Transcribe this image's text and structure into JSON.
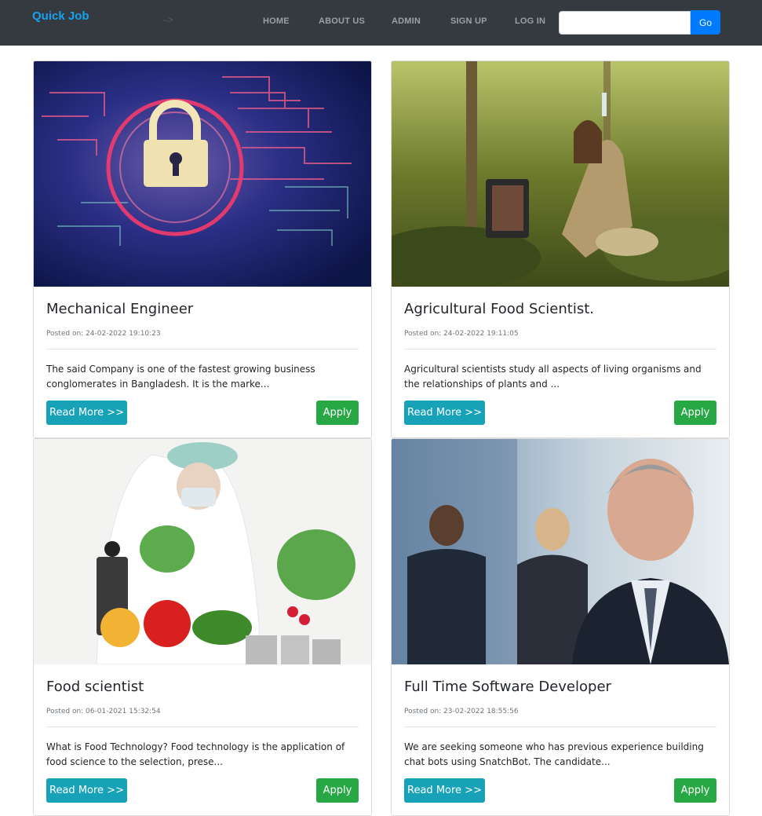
{
  "nav": {
    "brand": "Quick Job",
    "stray_text": "-->",
    "links": [
      "HOME",
      "ABOUT US",
      "ADMIN",
      "SIGN UP",
      "LOG IN"
    ],
    "search_value": "",
    "search_button": "Go"
  },
  "colors": {
    "navbar_bg": "#343a40",
    "brand": "#17a2f0",
    "read_more": "#17a2b8",
    "apply": "#28a745",
    "go": "#007bff"
  },
  "jobs": [
    {
      "image": "padlock-circuit-image",
      "title": "Mechanical Engineer",
      "posted": "Posted on: 24-02-2022 19:10:23",
      "description": "The said Company is one of the fastest growing business conglomerates in Bangladesh. It is the marke...",
      "read_more": "Read More >>",
      "apply": "Apply"
    },
    {
      "image": "scientist-in-forest-image",
      "title": "Agricultural Food Scientist.",
      "posted": "Posted on: 24-02-2022 19:11:05",
      "description": "Agricultural scientists study all aspects of living organisms and the relationships of plants and ...",
      "read_more": "Read More >>",
      "apply": "Apply"
    },
    {
      "image": "food-lab-image",
      "title": "Food scientist",
      "posted": "Posted on: 06-01-2021 15:32:54",
      "description": "What is Food Technology? Food technology is the application of food science to the selection, prese...",
      "read_more": "Read More >>",
      "apply": "Apply"
    },
    {
      "image": "businessman-image",
      "title": "Full Time Software Developer",
      "posted": "Posted on: 23-02-2022 18:55:56",
      "description": "We are seeking someone who has previous experience building chat bots using SnatchBot. The candidate...",
      "read_more": "Read More >>",
      "apply": "Apply"
    }
  ]
}
